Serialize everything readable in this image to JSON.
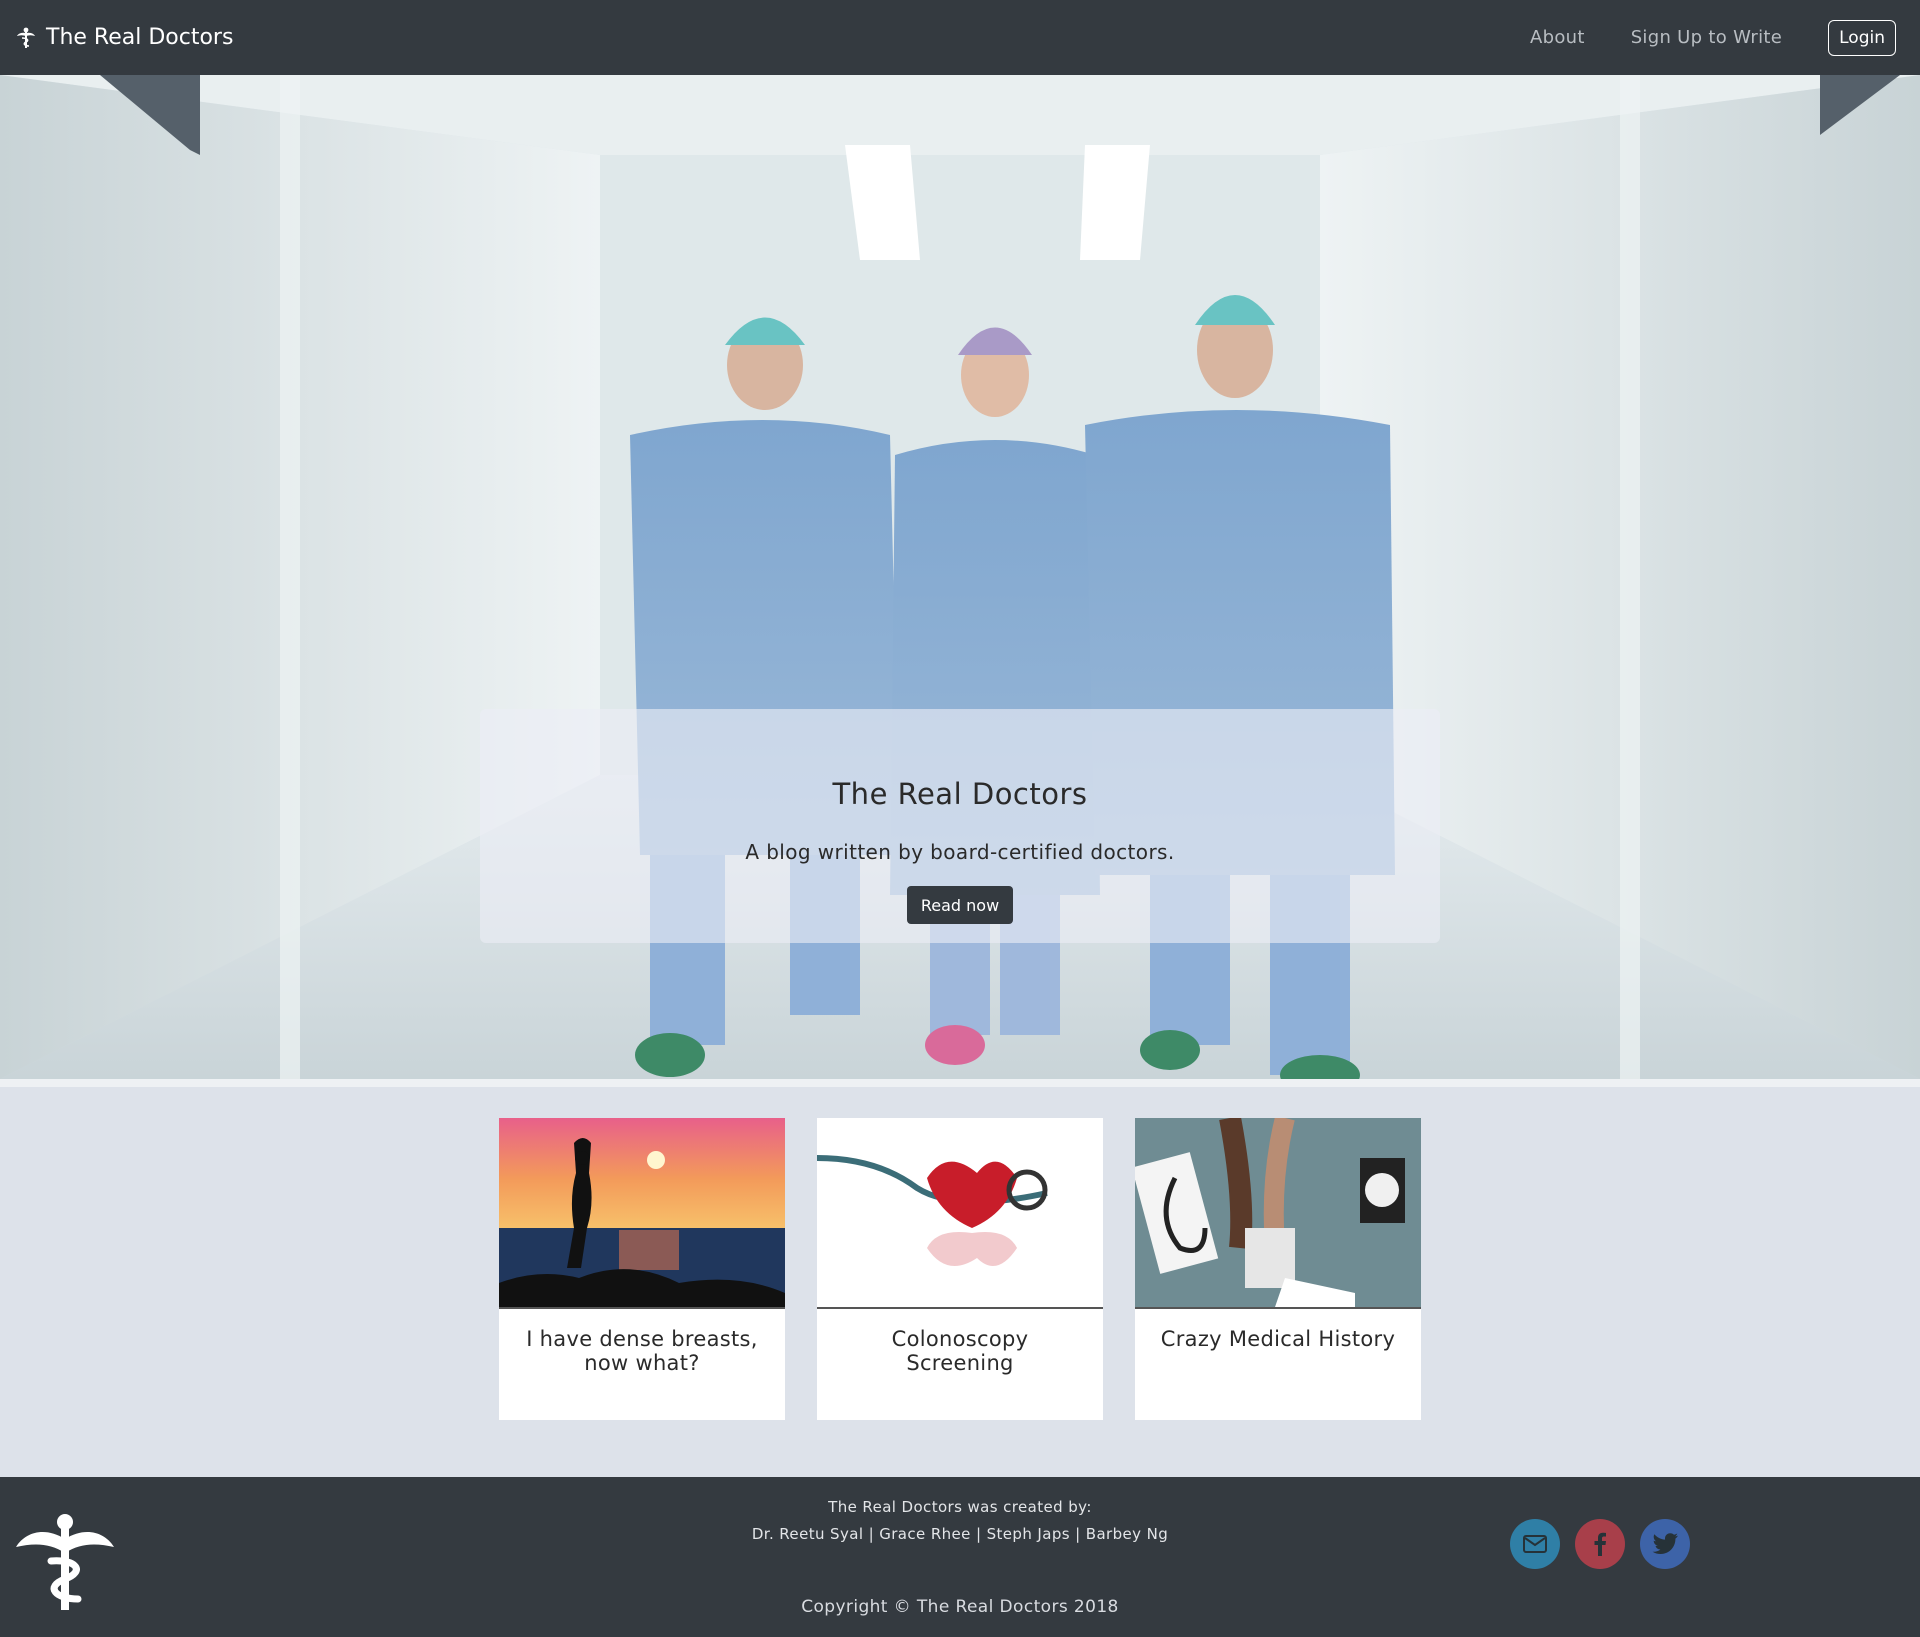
{
  "navbar": {
    "brand": "The Real Doctors",
    "brand_icon": "caduceus-icon",
    "links": [
      "About",
      "Sign Up to Write"
    ],
    "login": "Login"
  },
  "hero": {
    "title": "The Real Doctors",
    "subtitle": "A blog written by board-certified doctors.",
    "button": "Read now"
  },
  "cards": [
    {
      "title": "I have dense breasts, now what?",
      "image": "yoga-sunset-image"
    },
    {
      "title": "Colonoscopy Screening",
      "image": "stethoscope-heart-image"
    },
    {
      "title": "Crazy Medical History",
      "image": "blood-pressure-image"
    }
  ],
  "footer": {
    "created_by": "The Real Doctors was created by:",
    "names": "Dr. Reetu Syal | Grace Rhee | Steph Japs | Barbey Ng",
    "copyright": "Copyright © The Real Doctors 2018",
    "social": [
      {
        "icon": "email-icon",
        "color": "#2f7fa6"
      },
      {
        "icon": "facebook-icon",
        "color": "#a83f4a"
      },
      {
        "icon": "twitter-icon",
        "color": "#3d63a8"
      }
    ]
  },
  "colors": {
    "navbar_bg": "#343a40",
    "page_bg": "#dde2ea",
    "footer_bg": "#343a40"
  }
}
